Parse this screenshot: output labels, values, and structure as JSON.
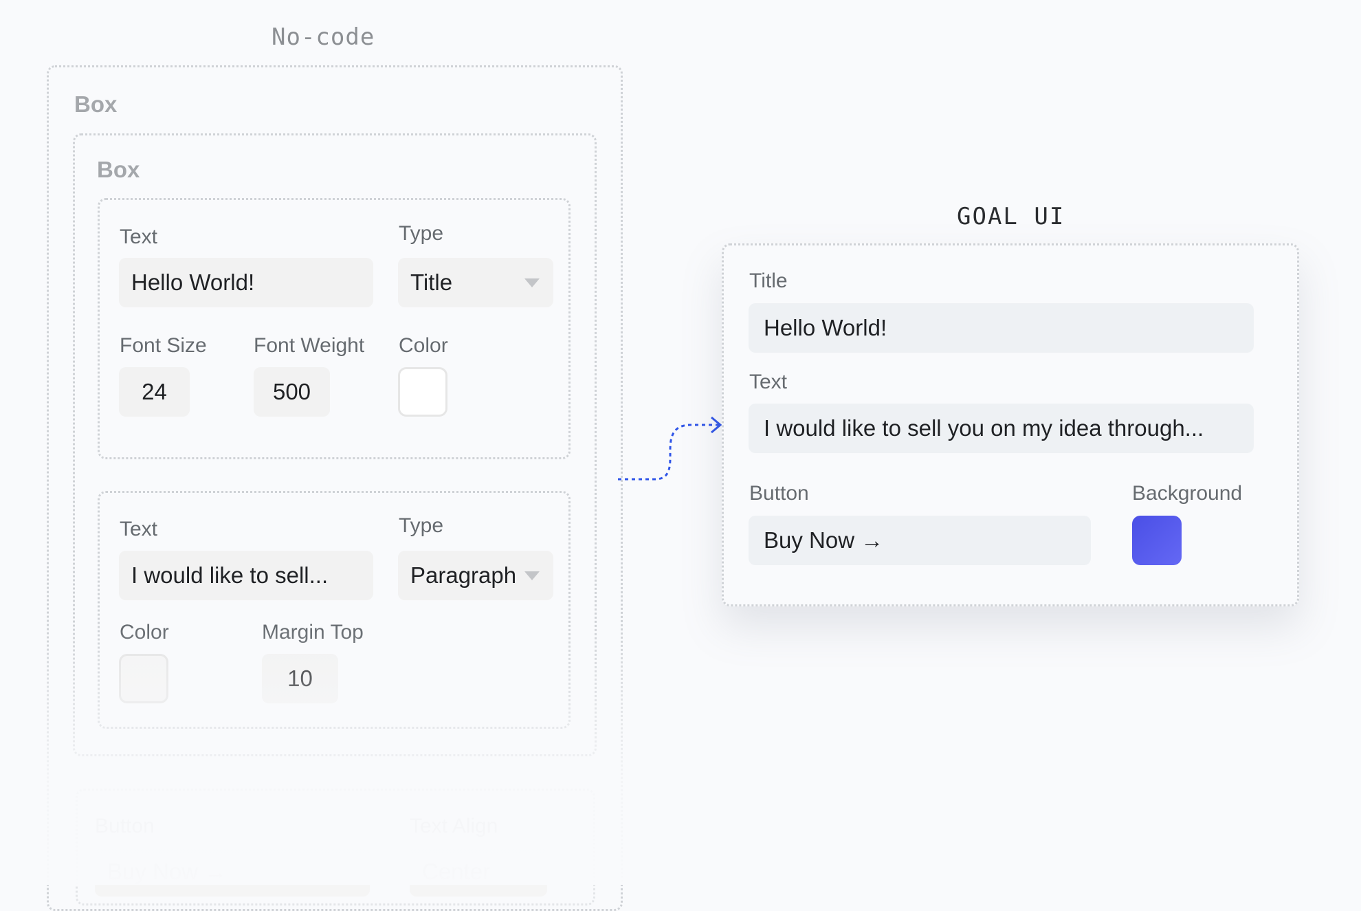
{
  "nocode": {
    "heading": "No-code",
    "outer_box_label": "Box",
    "inner_box_label": "Box",
    "block1": {
      "text_label": "Text",
      "text_value": "Hello World!",
      "type_label": "Type",
      "type_value": "Title",
      "font_size_label": "Font Size",
      "font_size_value": "24",
      "font_weight_label": "Font Weight",
      "font_weight_value": "500",
      "color_label": "Color",
      "color_value": "#ffffff"
    },
    "block2": {
      "text_label": "Text",
      "text_value": "I would like to sell...",
      "type_label": "Type",
      "type_value": "Paragraph",
      "color_label": "Color",
      "color_value": "#f4f4f4",
      "margin_top_label": "Margin Top",
      "margin_top_value": "10"
    },
    "block3": {
      "button_label": "Button",
      "button_value": "Buy Now →",
      "text_align_label": "Text Align",
      "text_align_value": "Center"
    }
  },
  "goal": {
    "heading": "GOAL UI",
    "title_label": "Title",
    "title_value": "Hello World!",
    "text_label": "Text",
    "text_value": "I would like to sell you on my idea through...",
    "button_label": "Button",
    "button_value": "Buy Now →",
    "background_label": "Background",
    "background_color": "#5458ee"
  },
  "colors": {
    "connector": "#2f55e8",
    "dotted_border": "#cfd2d6"
  }
}
